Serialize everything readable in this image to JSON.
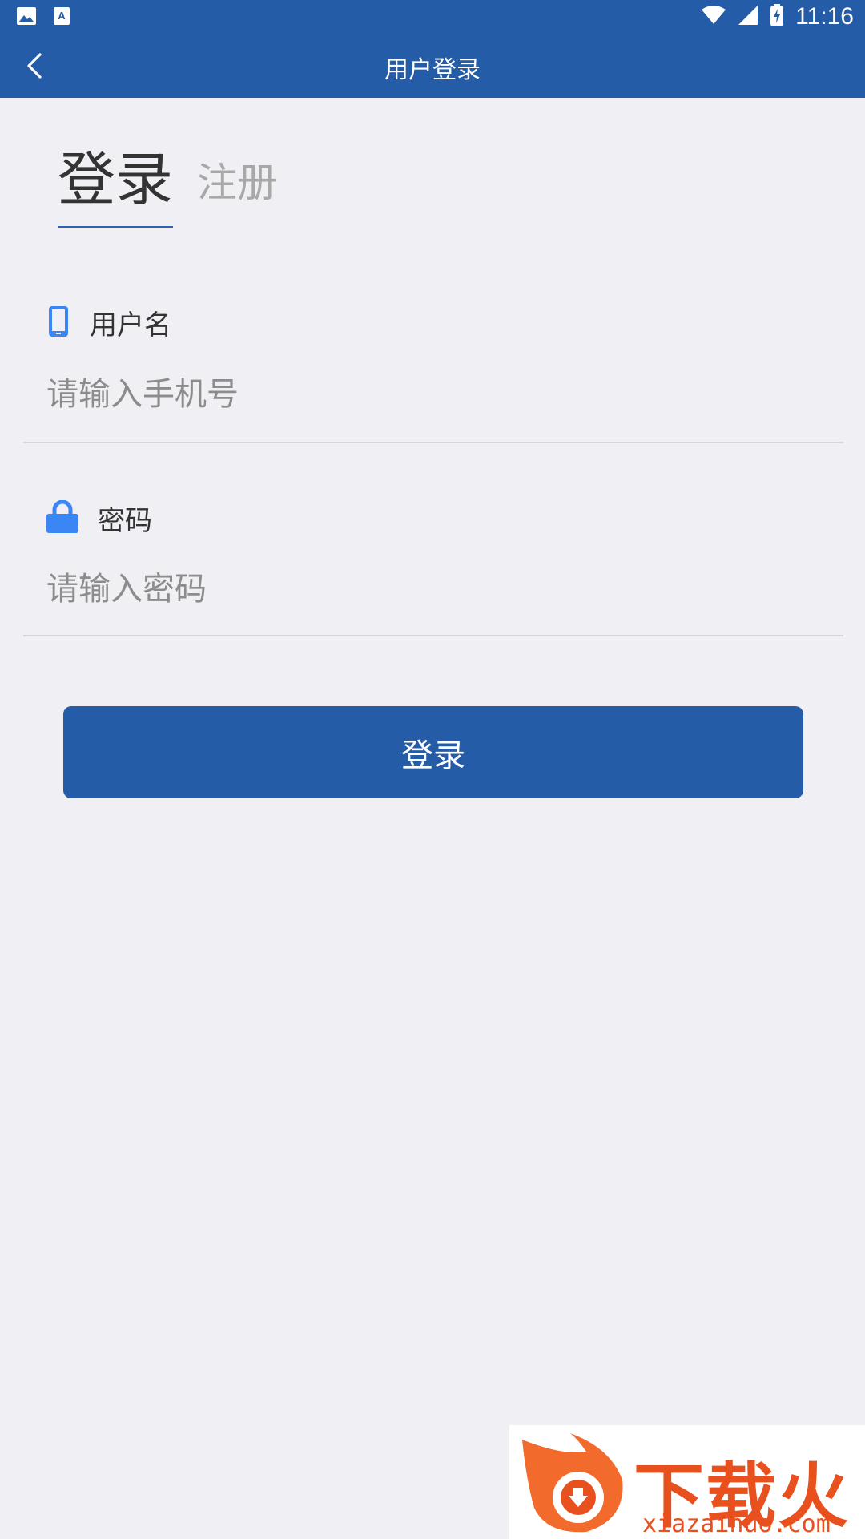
{
  "status_bar": {
    "time": "11:16",
    "icons_left": [
      "image-icon",
      "font-icon"
    ],
    "icons_right": [
      "wifi-icon",
      "signal-icon",
      "battery-charging-icon"
    ]
  },
  "app_bar": {
    "title": "用户登录",
    "back_icon": "chevron-left-icon"
  },
  "tabs": {
    "login": "登录",
    "register": "注册",
    "active": "login"
  },
  "form": {
    "username": {
      "label": "用户名",
      "icon": "phone-icon",
      "placeholder": "请输入手机号",
      "value": ""
    },
    "password": {
      "label": "密码",
      "icon": "lock-icon",
      "placeholder": "请输入密码",
      "value": ""
    },
    "submit_label": "登录"
  },
  "watermark": {
    "text": "下载火",
    "url": "xiazaihuo.com"
  },
  "colors": {
    "primary": "#255ca8",
    "background": "#efeff4",
    "icon_blue": "#3b86f5",
    "watermark": "#e8501e"
  }
}
